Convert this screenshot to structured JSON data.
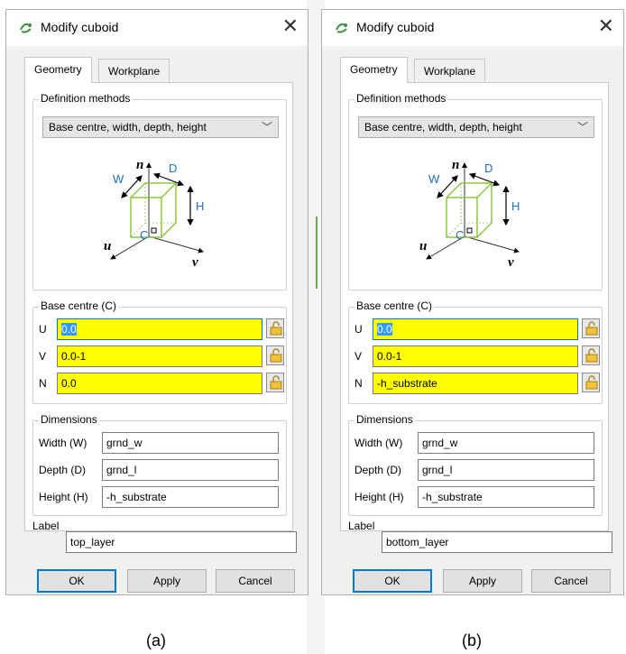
{
  "captions": [
    "(a)",
    "(b)"
  ],
  "colors": {
    "field_highlight": "#ffff00",
    "selection": "#3399ff",
    "focus_border": "#0078d7",
    "cuboid_green": "#8dc63f",
    "dim_label_blue": "#1e6fbf"
  },
  "dialogs": [
    {
      "title": "Modify cuboid",
      "close_glyph": "✕",
      "tabs": [
        "Geometry",
        "Workplane"
      ],
      "definition_methods": {
        "group_title": "Definition methods",
        "selected": "Base centre, width, depth, height"
      },
      "diagram_labels": {
        "n": "n",
        "w": "W",
        "d": "D",
        "h": "H",
        "c": "C",
        "u": "u",
        "v": "v"
      },
      "base_centre": {
        "group_title": "Base centre (C)",
        "rows": [
          {
            "label": "U",
            "value": "0.0",
            "selected": true
          },
          {
            "label": "V",
            "value": "0.0-1",
            "selected": false
          },
          {
            "label": "N",
            "value": "0.0",
            "selected": false
          }
        ]
      },
      "dimensions": {
        "group_title": "Dimensions",
        "rows": [
          {
            "label": "Width (W)",
            "value": "grnd_w"
          },
          {
            "label": "Depth (D)",
            "value": "grnd_l"
          },
          {
            "label": "Height (H)",
            "value": "-h_substrate"
          }
        ]
      },
      "label": {
        "label": "Label",
        "value": "top_layer"
      },
      "buttons": {
        "ok": "OK",
        "apply": "Apply",
        "cancel": "Cancel"
      }
    },
    {
      "title": "Modify cuboid",
      "close_glyph": "✕",
      "tabs": [
        "Geometry",
        "Workplane"
      ],
      "definition_methods": {
        "group_title": "Definition methods",
        "selected": "Base centre, width, depth, height"
      },
      "diagram_labels": {
        "n": "n",
        "w": "W",
        "d": "D",
        "h": "H",
        "c": "C",
        "u": "u",
        "v": "v"
      },
      "base_centre": {
        "group_title": "Base centre (C)",
        "rows": [
          {
            "label": "U",
            "value": "0.0",
            "selected": true
          },
          {
            "label": "V",
            "value": "0.0-1",
            "selected": false
          },
          {
            "label": "N",
            "value": "-h_substrate",
            "selected": false
          }
        ]
      },
      "dimensions": {
        "group_title": "Dimensions",
        "rows": [
          {
            "label": "Width (W)",
            "value": "grnd_w"
          },
          {
            "label": "Depth (D)",
            "value": "grnd_l"
          },
          {
            "label": "Height (H)",
            "value": "-h_substrate"
          }
        ]
      },
      "label": {
        "label": "Label",
        "value": "bottom_layer"
      },
      "buttons": {
        "ok": "OK",
        "apply": "Apply",
        "cancel": "Cancel"
      }
    }
  ]
}
